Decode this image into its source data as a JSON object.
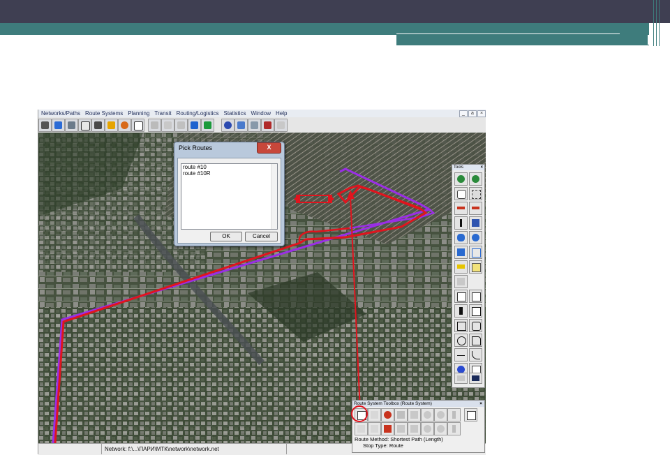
{
  "menu": {
    "items": [
      "Networks/Paths",
      "Route Systems",
      "Planning",
      "Transit",
      "Routing/Logistics",
      "Statistics",
      "Window",
      "Help"
    ],
    "minimize": "_",
    "restore": "а",
    "close": "×"
  },
  "status": {
    "network": "Network: f:\\...\\ПАРИ\\МТК\\network\\network.net"
  },
  "dialog": {
    "title": "Pick Routes",
    "close": "X",
    "routes": [
      "route #10",
      "route #10R"
    ],
    "ok": "OK",
    "cancel": "Cancel"
  },
  "tools": {
    "title": "Tools",
    "close": "×"
  },
  "route_toolbox": {
    "title": "Route System Toolbox (Route System)",
    "close": "×",
    "method_label": "Route Method:",
    "method_value": "Shortest Path (Length)",
    "stop_label": "Stop Type:",
    "stop_value": "Route"
  },
  "colors": {
    "route_red": "#e0141e",
    "route_purple": "#9a2ee6",
    "accent_teal": "#3e7c7c",
    "slide_dark": "#3f3f52"
  }
}
